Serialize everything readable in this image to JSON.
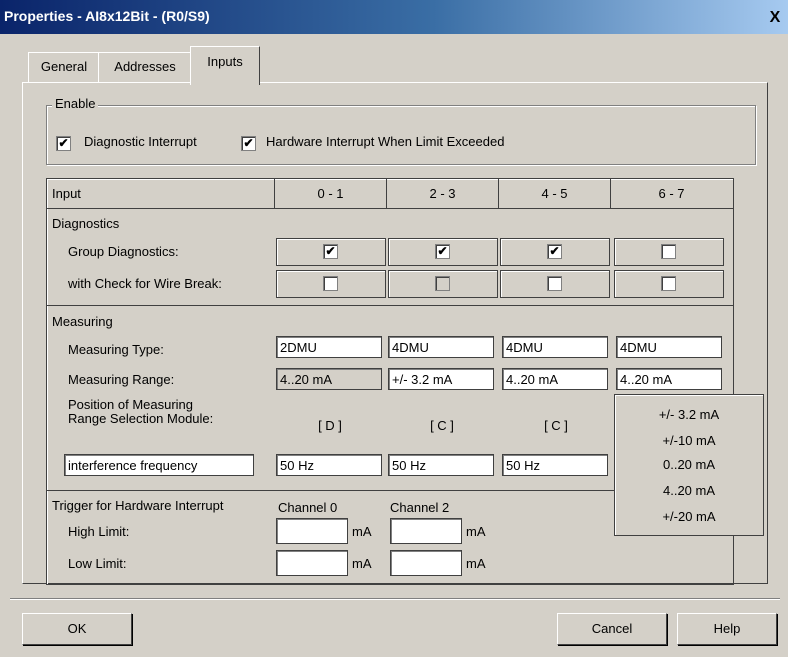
{
  "window": {
    "title": "Properties - AI8x12Bit - (R0/S9)",
    "close_glyph": "X"
  },
  "tabs": [
    {
      "label": "General"
    },
    {
      "label": "Addresses"
    },
    {
      "label": "Inputs"
    }
  ],
  "enable": {
    "legend": "Enable",
    "diagnostic_interrupt": {
      "label": "Diagnostic Interrupt",
      "checked": true
    },
    "hardware_interrupt": {
      "label": "Hardware Interrupt When Limit Exceeded",
      "checked": true
    }
  },
  "table": {
    "input_header": "Input",
    "channels": [
      "0 - 1",
      "2 - 3",
      "4 - 5",
      "6 - 7"
    ],
    "diagnostics": {
      "title": "Diagnostics",
      "group_label": "Group Diagnostics:",
      "group_checked": [
        true,
        true,
        true,
        false
      ],
      "wire_label": "with Check for Wire Break:",
      "wire_checked": [
        false,
        false,
        false,
        false
      ]
    },
    "measuring": {
      "title": "Measuring",
      "type_label": "Measuring Type:",
      "types": [
        "2DMU",
        "4DMU",
        "4DMU",
        "4DMU"
      ],
      "range_label": "Measuring Range:",
      "ranges": [
        "4..20 mA",
        "+/- 3.2 mA",
        "4..20 mA",
        "4..20 mA"
      ],
      "position_label_1": "Position of Measuring",
      "position_label_2": "Range Selection Module:",
      "positions": [
        "[ D ]",
        "[ C ]",
        "[ C ]"
      ],
      "freq_select": "interference frequency",
      "freqs": [
        "50 Hz",
        "50 Hz",
        "50 Hz"
      ]
    },
    "trigger": {
      "title": "Trigger for Hardware Interrupt",
      "channel0": "Channel 0",
      "channel2": "Channel 2",
      "high_label": "High Limit:",
      "low_label": "Low Limit:",
      "unit": "mA"
    }
  },
  "range_dropdown": [
    "+/- 3.2 mA",
    "+/-10 mA",
    "0..20 mA",
    "4..20 mA",
    "+/-20 mA"
  ],
  "buttons": {
    "ok": "OK",
    "cancel": "Cancel",
    "help": "Help"
  }
}
